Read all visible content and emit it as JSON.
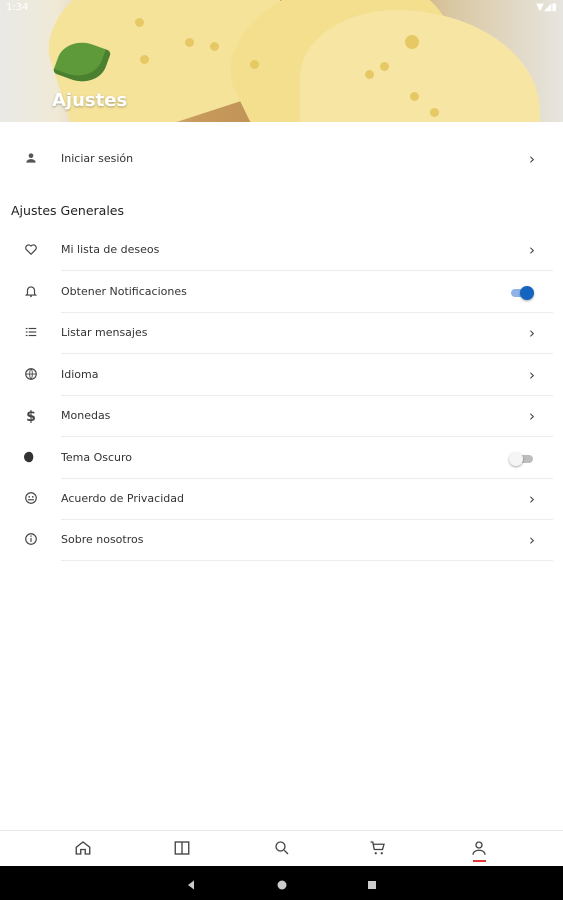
{
  "header": {
    "title": "Ajustes",
    "status_time": "1:34"
  },
  "login": {
    "label": "Iniciar sesión",
    "icon": "person-icon"
  },
  "section": {
    "title": "Ajustes Generales"
  },
  "settings": [
    {
      "label": "Mi lista de deseos",
      "icon": "heart-icon",
      "control": "chevron"
    },
    {
      "label": "Obtener Notificaciones",
      "icon": "bell-icon",
      "control": "toggle",
      "on": true
    },
    {
      "label": "Listar mensajes",
      "icon": "list-icon",
      "control": "chevron"
    },
    {
      "label": "Idioma",
      "icon": "globe-icon",
      "control": "chevron"
    },
    {
      "label": "Monedas",
      "icon": "dollar-icon",
      "control": "chevron"
    },
    {
      "label": "Tema Oscuro",
      "icon": "moon-icon",
      "control": "toggle",
      "on": false
    },
    {
      "label": "Acuerdo de Privacidad",
      "icon": "privacy-icon",
      "control": "chevron"
    },
    {
      "label": "Sobre nosotros",
      "icon": "info-icon",
      "control": "chevron"
    }
  ],
  "bottom_nav": [
    {
      "name": "home",
      "icon": "home-icon"
    },
    {
      "name": "categories",
      "icon": "book-icon"
    },
    {
      "name": "search",
      "icon": "search-icon"
    },
    {
      "name": "cart",
      "icon": "cart-icon"
    },
    {
      "name": "account",
      "icon": "account-icon",
      "active": true
    }
  ],
  "colors": {
    "accent": "#1565c0",
    "active_underline": "#e53935",
    "text": "#333333"
  }
}
